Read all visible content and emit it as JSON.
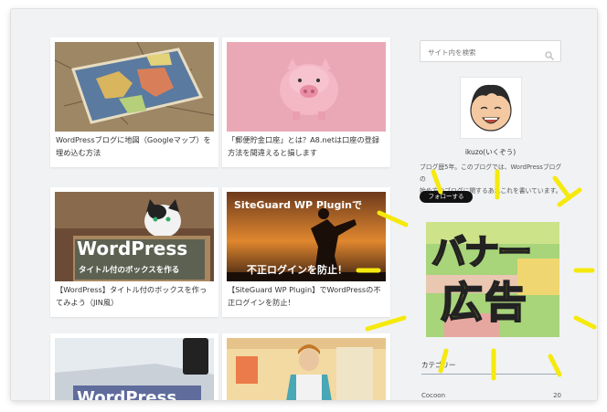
{
  "articles": [
    {
      "title_line1": "WordPressブログに地図（Googleマップ）を",
      "title_line2": "埋め込む方法"
    },
    {
      "title_line1": "「郵便貯金口座」とは？A8.netは口座の登録",
      "title_line2": "方法を間違えると損します"
    },
    {
      "title_line1": "【WordPress】タイトル付のボックスを作っ",
      "title_line2": "てみよう（JIN風）",
      "thumb_text_big": "WordPress",
      "thumb_text_small": "タイトル付のボックスを作る"
    },
    {
      "title_line1": "【SiteGuard WP Plugin】でWordPressの不",
      "title_line2": "正ログインを防止！",
      "thumb_text_top": "SiteGuard WP Pluginで",
      "thumb_text_bottom": "不正ログインを防止！"
    },
    {
      "thumb_text_big": "WordPress"
    },
    {}
  ],
  "sidebar": {
    "search_placeholder": "サイト内を検索",
    "profile_name": "ikuzo(いくぞう)",
    "profile_desc_line1": "ブログ歴5年。このブログでは、WordPressブログの",
    "profile_desc_line2": "始め方やブログに関するあれこれを書いています。",
    "follow_label": "フォローする",
    "banner_line1": "バナー",
    "banner_line2": "広告",
    "category_heading": "カテゴリー",
    "categories": [
      {
        "name": "Cocoon",
        "count": "20"
      }
    ]
  },
  "colors": {
    "banner_yellow": "#f5e90e",
    "banner_bg": "#a8d47a",
    "pig_bg": "#e9a7b4"
  }
}
